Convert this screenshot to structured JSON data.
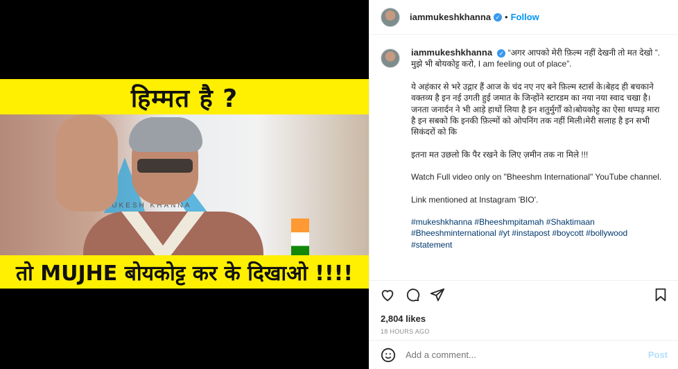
{
  "header": {
    "username": "iammukeshkhanna",
    "separator": "•",
    "follow_label": "Follow"
  },
  "media": {
    "headline_top": "हिम्मत है ?",
    "headline_bottom": "तो MUJHE बोयकोट्ट कर के दिखाओ !!!!",
    "wall_text": "MUKESH KHANNA"
  },
  "caption": {
    "username": "iammukeshkhanna",
    "para1": "“अगर आपको मेरी फ़िल्म नहीं देखनी तो मत देखो ”. मुझे भी बोयकोट्ट करो, I am feeling out of place”.",
    "para2": "ये अहंकार से भरे उद्गार हैं आज के चंद नए नए बने फ़िल्म स्टार्स के।बेहद ही बचकाने वक्तव्य है इन नई उगती हुई जमात के जिन्होंने स्टारडम का नया नया स्वाद चखा है। जनता जनार्दन ने भी आड़े हाथों लिया है इन शतुर्मुर्गों को।बोयकोट्ट का ऐसा थप्पड़ मारा है इन सबको कि इनकी फ़िल्मों को ओपनिंग तक नहीं मिली।मेरी सलाह है इन सभी सिकंदरों को कि",
    "para3": "इतना मत उछलो कि पैर रखने के लिए ज़मीन तक ना मिले !!!",
    "para4": "Watch Full video only on \"Bheeshm International\" YouTube channel.",
    "para5": "Link mentioned at Instagram 'BIO'.",
    "hashtags": "#mukeshkhanna #Bheeshmpitamah #Shaktimaan #Bheeshminternational #yt #instapost #boycott #bollywood #statement"
  },
  "stats": {
    "likes": "2,804 likes",
    "time": "18 HOURS AGO"
  },
  "comment": {
    "placeholder": "Add a comment...",
    "post_label": "Post"
  },
  "icons": [
    "heart-icon",
    "comment-icon",
    "share-icon",
    "bookmark-icon",
    "emoji-icon",
    "verified-badge-icon"
  ],
  "colors": {
    "accent": "#0095f6",
    "hashtag": "#00376b",
    "banner_yellow": "#ffef00"
  }
}
